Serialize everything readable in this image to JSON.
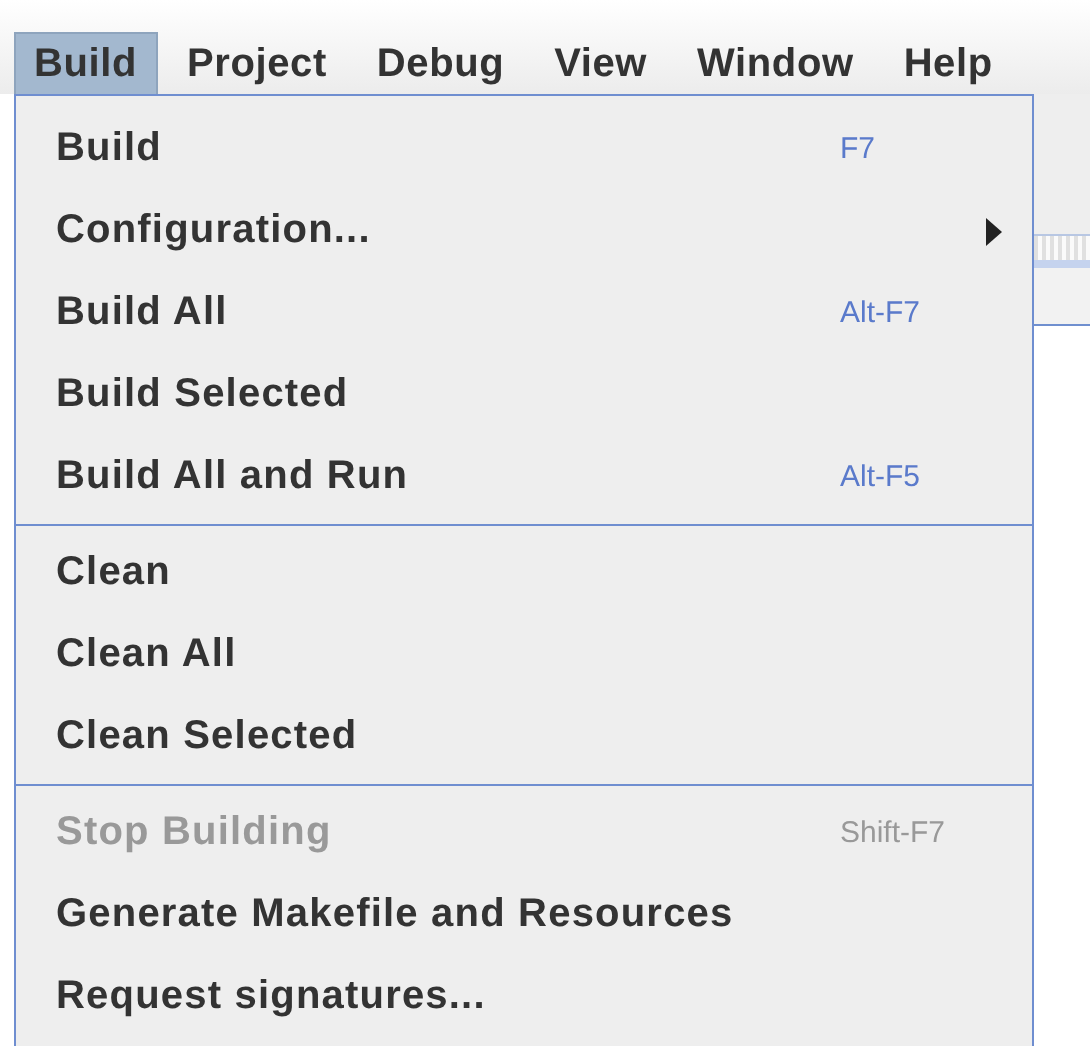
{
  "menubar": [
    {
      "label": "Build",
      "selected": true
    },
    {
      "label": "Project",
      "selected": false
    },
    {
      "label": "Debug",
      "selected": false
    },
    {
      "label": "View",
      "selected": false
    },
    {
      "label": "Window",
      "selected": false
    },
    {
      "label": "Help",
      "selected": false
    }
  ],
  "menu": {
    "groups": [
      {
        "items": [
          {
            "label": "Build",
            "shortcut": "F7",
            "disabled": false,
            "submenu": false
          },
          {
            "label": "Configuration...",
            "disabled": false,
            "submenu": true
          },
          {
            "label": "Build All",
            "shortcut": "Alt-F7",
            "disabled": false,
            "submenu": false
          },
          {
            "label": "Build Selected",
            "disabled": false,
            "submenu": false
          },
          {
            "label": "Build All and Run",
            "shortcut": "Alt-F5",
            "disabled": false,
            "submenu": false
          }
        ]
      },
      {
        "items": [
          {
            "label": "Clean",
            "disabled": false,
            "submenu": false
          },
          {
            "label": "Clean All",
            "disabled": false,
            "submenu": false
          },
          {
            "label": "Clean Selected",
            "disabled": false,
            "submenu": false
          }
        ]
      },
      {
        "items": [
          {
            "label": "Stop Building",
            "shortcut": "Shift-F7",
            "disabled": true,
            "submenu": false
          },
          {
            "label": "Generate Makefile and Resources",
            "disabled": false,
            "submenu": false
          },
          {
            "label": "Request signatures...",
            "disabled": false,
            "submenu": false
          }
        ]
      }
    ]
  }
}
